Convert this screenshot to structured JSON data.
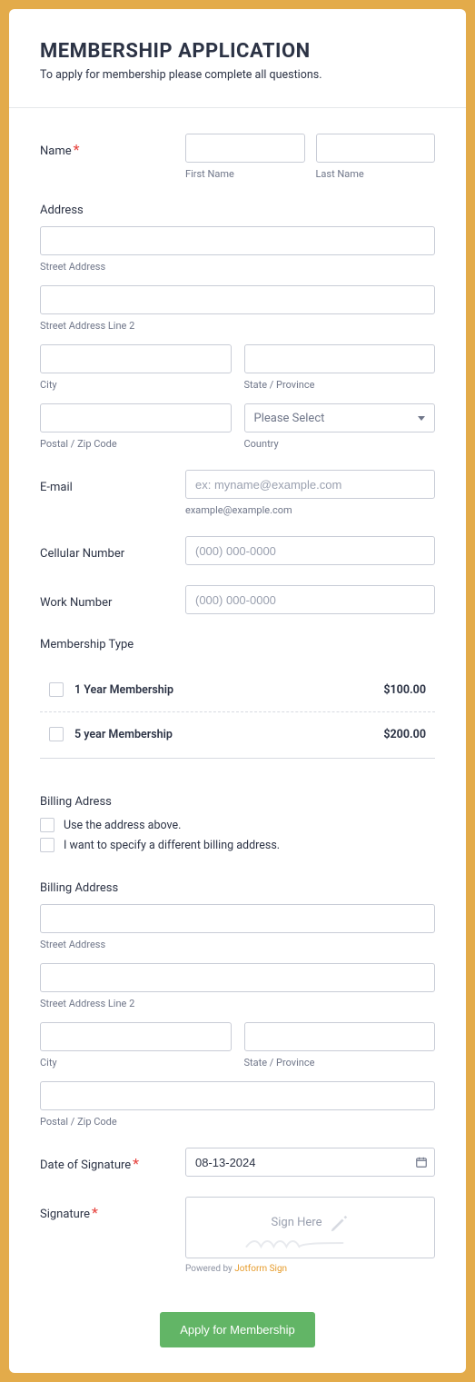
{
  "header": {
    "title": "MEMBERSHIP APPLICATION",
    "subtitle": "To apply for membership please complete all questions."
  },
  "name": {
    "label": "Name",
    "first_sub": "First Name",
    "last_sub": "Last Name"
  },
  "address": {
    "label": "Address",
    "street_sub": "Street Address",
    "street2_sub": "Street Address Line 2",
    "city_sub": "City",
    "state_sub": "State / Province",
    "postal_sub": "Postal / Zip Code",
    "country_sub": "Country",
    "country_placeholder": "Please Select"
  },
  "email": {
    "label": "E-mail",
    "placeholder": "ex: myname@example.com",
    "hint": "example@example.com"
  },
  "cell": {
    "label": "Cellular Number",
    "placeholder": "(000) 000-0000"
  },
  "work": {
    "label": "Work Number",
    "placeholder": "(000) 000-0000"
  },
  "membership": {
    "label": "Membership Type",
    "items": [
      {
        "name": "1 Year Membership",
        "price": "$100.00"
      },
      {
        "name": "5 year Membership",
        "price": "$200.00"
      }
    ]
  },
  "billing_choice": {
    "label": "Billing Adress",
    "opt1": "Use the address above.",
    "opt2": "I want to specify a different billing address."
  },
  "billing": {
    "label": "Billing Address",
    "street_sub": "Street Address",
    "street2_sub": "Street Address Line 2",
    "city_sub": "City",
    "state_sub": "State / Province",
    "postal_sub": "Postal / Zip Code"
  },
  "sig_date": {
    "label": "Date of Signature",
    "value": "08-13-2024"
  },
  "signature": {
    "label": "Signature",
    "placeholder": "Sign Here",
    "powered_prefix": "Powered by ",
    "powered_link": "Jotform Sign"
  },
  "submit": {
    "label": "Apply for Membership"
  }
}
